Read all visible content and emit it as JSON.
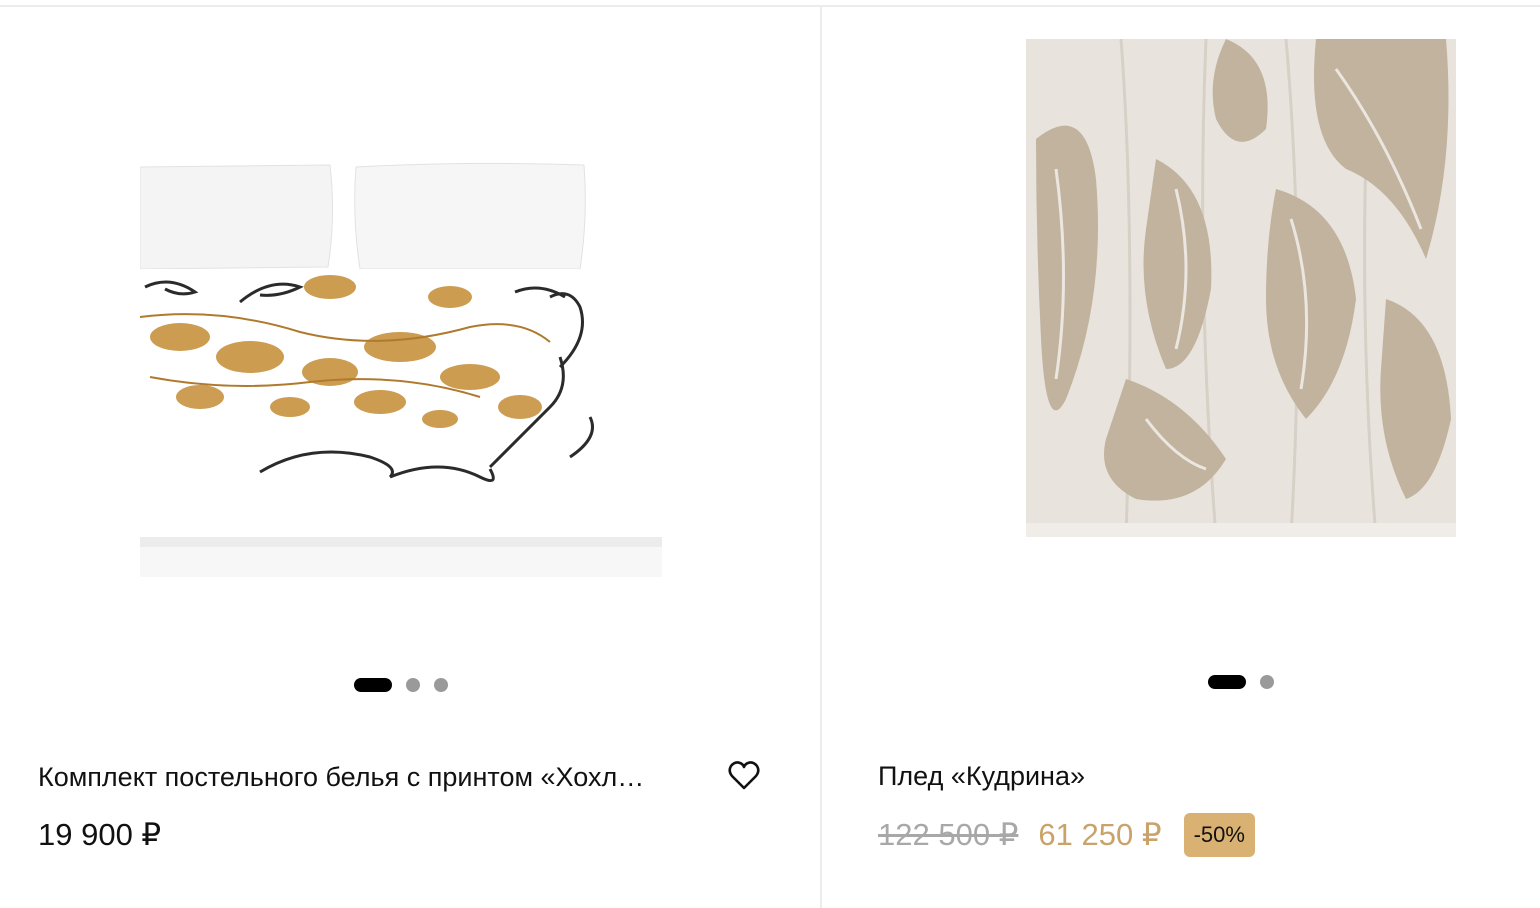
{
  "products": [
    {
      "title": "Комплект постельного белья с принтом «Хохл…",
      "price": "19 900 ₽",
      "image_icon": "bedding-image",
      "favorite_icon": "heart-outline-icon",
      "slides": 3,
      "active_slide": 1
    },
    {
      "title": "Плед «Кудрина»",
      "old_price": "122 500 ₽",
      "price": "61 250 ₽",
      "discount": "-50%",
      "image_icon": "throw-blanket-image",
      "slides": 2,
      "active_slide": 1
    }
  ],
  "colors": {
    "sale_price": "#c9a36a",
    "discount_badge": "#d9b273",
    "old_price": "#a8a8a8",
    "blanket_pattern": "#c2b39f",
    "blanket_base": "#e8e4dd",
    "ornament_gold": "#c7923f",
    "ornament_black": "#2b2b2b"
  }
}
